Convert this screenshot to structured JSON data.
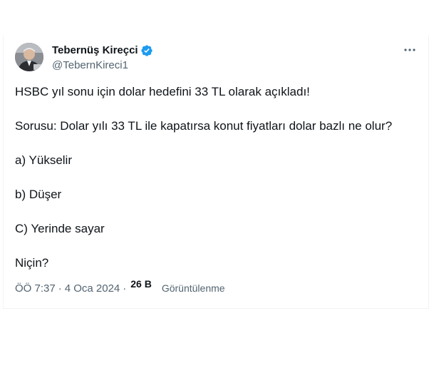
{
  "author": {
    "name": "Tebernüş Kireçci",
    "handle": "@TebernKireci1",
    "verified_color": "#1d9bf0"
  },
  "icons": {
    "verified": "verified-badge-icon",
    "more": "more-horizontal-icon"
  },
  "tweet": {
    "lines": [
      "HSBC yıl sonu için dolar hedefini 33 TL olarak açıkladı!",
      "Sorusu: Dolar yılı 33 TL ile kapatırsa konut fiyatları dolar bazlı ne olur?",
      "a) Yükselir",
      "b) Düşer",
      "C) Yerinde sayar",
      "Niçin?"
    ]
  },
  "meta": {
    "time": "ÖÖ 7:37",
    "separator": "·",
    "date": "4 Oca 2024",
    "views_count": "26 B",
    "views_label": "Görüntülenme"
  },
  "colors": {
    "text_primary": "#0f1419",
    "text_secondary": "#536471",
    "border": "#eff3f4"
  }
}
